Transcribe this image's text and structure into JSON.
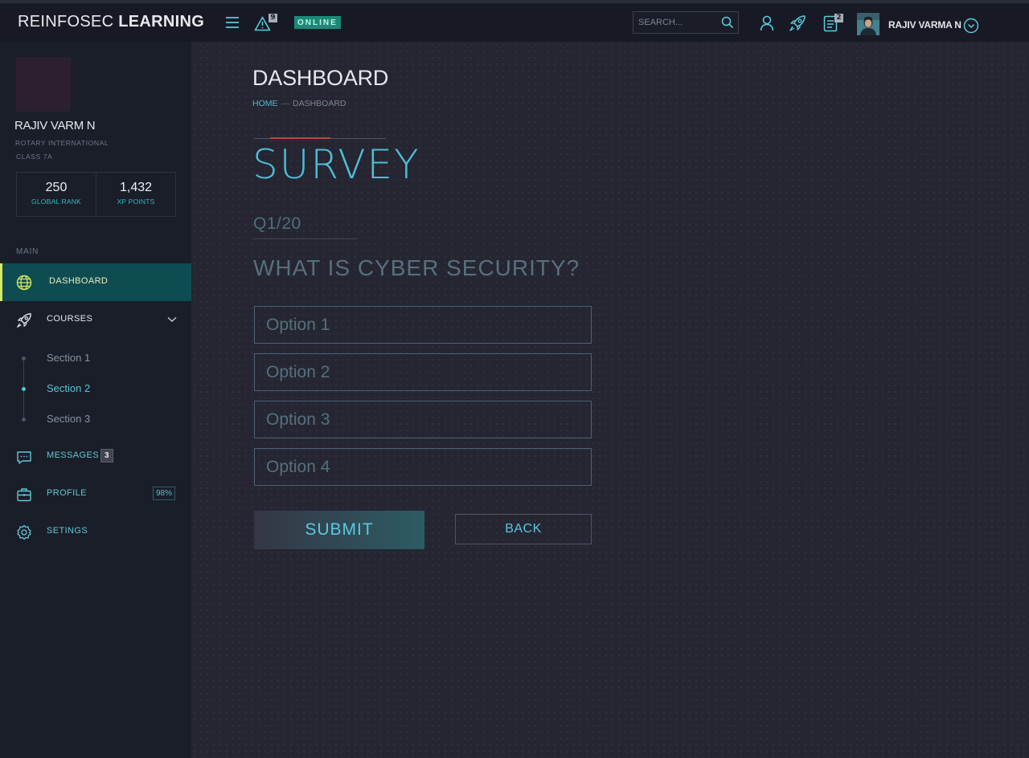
{
  "app": {
    "brand_light": "REINFOSEC",
    "brand_bold": "LEARNING",
    "accent_color": "#4fbfd8",
    "active_nav_color": "#0f4c52"
  },
  "topbar": {
    "alerts_count": "9",
    "status": "ONLINE",
    "search_placeholder": "SEARCH...",
    "tasks_count": "2",
    "user_name": "RAJIV VARMA N",
    "icons": [
      "menu-icon",
      "alert-icon",
      "search-icon",
      "user-icon",
      "rocket-icon",
      "document-icon",
      "avatar",
      "chevron-down-icon"
    ]
  },
  "sidebar": {
    "user_name": "RAJIV VARM N",
    "organization": "ROTARY INTERNATIONAL",
    "class": "CLASS 7A",
    "stats": [
      {
        "value": "250",
        "label": "GLOBAL RANK"
      },
      {
        "value": "1,432",
        "label": "XP POINTS"
      }
    ],
    "section_label": "MAIN",
    "nav": {
      "dashboard": "DASHBOARD",
      "courses": "COURSES",
      "messages": "MESSAGES",
      "messages_count": "3",
      "profile": "PROFILE",
      "profile_completion": "98%",
      "settings": "SETINGS"
    },
    "course_sections": [
      "Section 1",
      "Section 2",
      "Section 3"
    ],
    "active_section": "Section 2"
  },
  "main": {
    "page_title": "DASHBOARD",
    "breadcrumb_home": "HOME",
    "breadcrumb_current": "DASHBOARD",
    "survey_title": "SURVEY",
    "question_counter": "Q1/20",
    "question": "WHAT IS CYBER SECURITY?",
    "options": [
      "Option 1",
      "Option 2",
      "Option 3",
      "Option 4"
    ],
    "submit_label": "SUBMIT",
    "back_label": "BACK"
  }
}
